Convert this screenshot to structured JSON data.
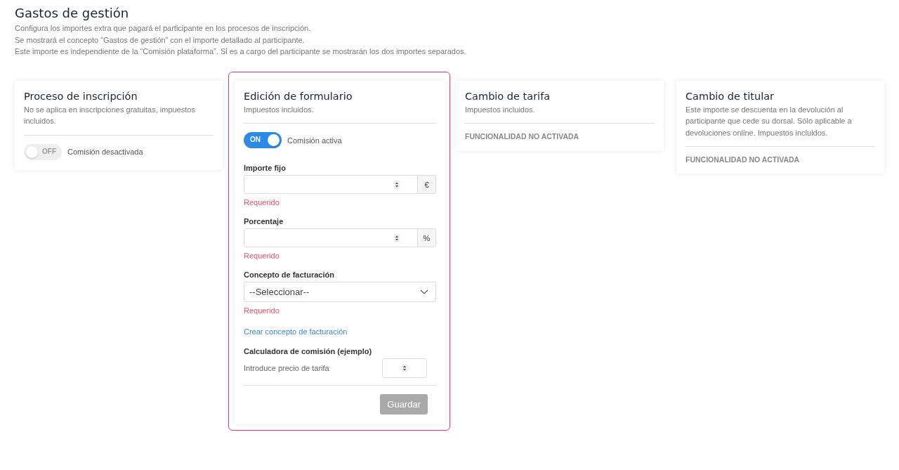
{
  "header": {
    "title": "Gastos de gestión",
    "lines": [
      "Configura los importes extra que pagará el participante en los procesos de inscripción.",
      "Se mostrará el concepto “Gastos de gestión” con el importe detallado al participante.",
      "Este importe es independiente de la “Comisión plataforma”. Si es a cargo del participante se mostrarán los dos importes separados."
    ]
  },
  "cards": [
    {
      "kind": "toggle",
      "selected": false,
      "title": "Proceso de inscripción",
      "description": "No se aplica en inscripciones gratuitas, impuestos incluidos.",
      "toggle": {
        "on": false,
        "text": "OFF",
        "label": "Comisión desactivada"
      }
    },
    {
      "kind": "form",
      "selected": true,
      "title": "Edición de formulario",
      "description": "Impuestos incluidos.",
      "toggle": {
        "on": true,
        "text": "ON",
        "label": "Comisión activa"
      },
      "fields": [
        {
          "kind": "number",
          "label": "Importe fijo",
          "unit": "€",
          "error": "Requerido"
        },
        {
          "kind": "number",
          "label": "Porcentaje",
          "unit": "%",
          "error": "Requerido"
        },
        {
          "kind": "select",
          "label": "Concepto de facturación",
          "value": "--Seleccionar--",
          "error": "Requerido"
        }
      ],
      "link": "Crear concepto de facturación",
      "calculator": {
        "title": "Calculadora de comisión (ejemplo)",
        "label": "Introduce precio de tarifa"
      },
      "button": {
        "label": "Guardar",
        "disabled": true
      }
    },
    {
      "kind": "inactive",
      "selected": false,
      "title": "Cambio de tarifa",
      "description": "Impuestos incluidos.",
      "status": "FUNCIONALIDAD NO ACTIVADA"
    },
    {
      "kind": "inactive",
      "selected": false,
      "title": "Cambio de titular",
      "description": "Este importe se descuenta en la devolución al participante que cede su dorsal. Sólo aplicable a devoluciones online. Impuestos incluidos.",
      "status": "FUNCIONALIDAD NO ACTIVADA"
    }
  ]
}
